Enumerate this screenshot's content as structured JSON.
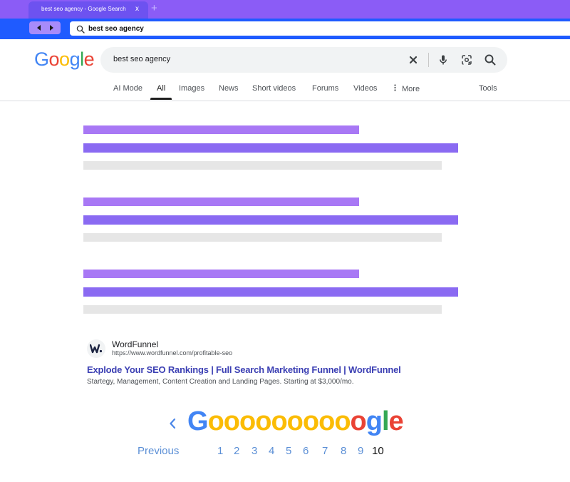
{
  "browser": {
    "tab_title": "best seo agency - Google Search",
    "tab_close": "x",
    "new_tab": "+",
    "address": "best seo agency"
  },
  "google": {
    "logo_letters": [
      "G",
      "o",
      "o",
      "g",
      "l",
      "e"
    ],
    "logo_colors": [
      "#4285F4",
      "#EA4335",
      "#FBBC05",
      "#4285F4",
      "#34A853",
      "#EA4335"
    ],
    "query": "best seo agency",
    "tabs": [
      {
        "label": "AI Mode",
        "active": false
      },
      {
        "label": "All",
        "active": true
      },
      {
        "label": "Images",
        "active": false
      },
      {
        "label": "News",
        "active": false
      },
      {
        "label": "Short videos",
        "active": false
      },
      {
        "label": "Forums",
        "active": false
      },
      {
        "label": "Videos",
        "active": false
      },
      {
        "label": "More",
        "active": false
      }
    ],
    "tools_label": "Tools"
  },
  "ad": {
    "site_name": "WordFunnel",
    "url": "https://www.wordfunnel.com/profitable-seo",
    "title": "Explode Your SEO Rankings | Full Search Marketing Funnel | WordFunnel",
    "description": "Startegy, Management, Content Creation and Landing Pages. Starting at $3,000/mo."
  },
  "pagination": {
    "logo_letters": [
      "G",
      "o",
      "o",
      "o",
      "o",
      "o",
      "o",
      "o",
      "o",
      "o",
      "o",
      "g",
      "l",
      "e"
    ],
    "previous_label": "Previous",
    "pages": [
      "1",
      "2",
      "3",
      "4",
      "5",
      "6",
      "7",
      "8",
      "9",
      "10"
    ],
    "current_page": "10"
  },
  "colors": {
    "tab_strip": "#8b5cf6",
    "toolbar": "#1f5bff",
    "placeholder_title": "#a878f5",
    "placeholder_link": "#8a6af2",
    "placeholder_snippet": "#e6e6e6",
    "ad_title": "#3b3fb3",
    "page_link": "#5b8fd6"
  }
}
